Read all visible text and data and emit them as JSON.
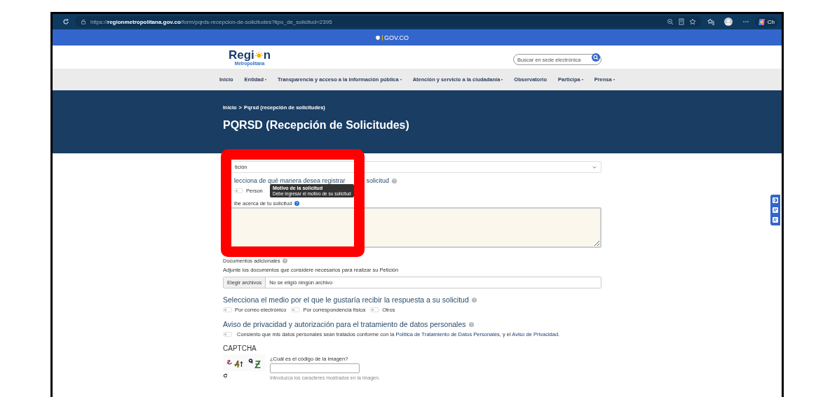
{
  "browser": {
    "url": "https://**regionmetropolitana.gov.co**/form/pqrds-recepcion-de-solicitudes?tipo_de_solicitud=2395",
    "profile_label": "Ch"
  },
  "gov_bar": {
    "label": "GOV.CO"
  },
  "header": {
    "logo_start": "Regi",
    "logo_end": "n",
    "logo_subtitle": "Metropolitana",
    "search": {
      "placeholder": "Buscar en sede electrónica"
    }
  },
  "nav": [
    {
      "label": "Inicio",
      "has_menu": false
    },
    {
      "label": "Entidad",
      "has_menu": true
    },
    {
      "label": "Transparencia y acceso a la información pública",
      "has_menu": true
    },
    {
      "label": "Atención y servicio a la ciudadanía",
      "has_menu": true
    },
    {
      "label": "Observatorio",
      "has_menu": false
    },
    {
      "label": "Participa",
      "has_menu": true
    },
    {
      "label": "Prensa",
      "has_menu": true
    }
  ],
  "hero": {
    "breadcrumb": [
      {
        "label": "Inicio"
      },
      {
        "label": "Pqrsd (recepción de solicitudes)"
      }
    ],
    "separator": ">",
    "title": "PQRSD (Recepción de Solicitudes)"
  },
  "form": {
    "request_type": {
      "value": "tición"
    },
    "register_heading": {
      "before": "lecciona de qué manera desea registrar",
      "after": "solicitud"
    },
    "register_options": [
      {
        "label": "Person",
        "selected": false
      }
    ],
    "tooltip": {
      "title": "Motivo de la solicitud",
      "text": "Debe ingresar el motivo de su solicitud"
    },
    "description_label": "ibe acerca de tu solicitud",
    "documents": {
      "label": "Documentos adicionales",
      "helper": "Adjunte los documentos que considere necesarios para realizar su Petición",
      "button": "Elegir archivos",
      "status": "No se eligió ningún archivo"
    },
    "medium_heading": "Selecciona el medio por el que le gustaría recibir la respuesta a su solicitud",
    "medium_options": [
      {
        "label": "Por correo electrónico",
        "selected": false
      },
      {
        "label": "Por correspondencia física",
        "selected": false
      },
      {
        "label": "Otros",
        "selected": false
      }
    ],
    "privacy_heading": "Aviso de privacidad y autorización para el tratamiento de datos personales",
    "consent": {
      "checked": false,
      "text": "Consiento que mis datos personales sean tratados conforme con la",
      "link_1": "Política de Tratamiento de Datos Personales",
      "middle": ", y el",
      "link_2": "Aviso de Privacidad",
      "end": "."
    },
    "captcha": {
      "title": "CAPTCHA",
      "question": "¿Cuál es el código de la imagen?",
      "hint": "Introduzca los caracteres mostrados en la imagen."
    }
  },
  "annotation": {
    "kind": "highlight-box",
    "color": "#ff0000"
  }
}
